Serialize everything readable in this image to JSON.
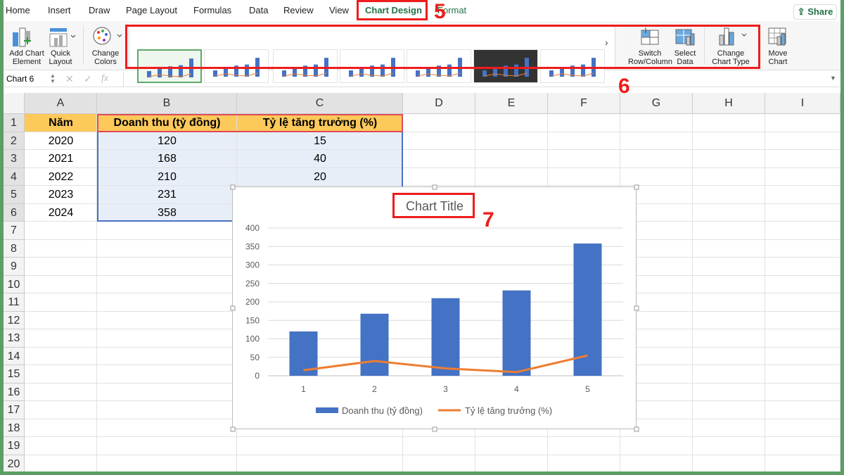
{
  "tabs": [
    "Home",
    "Insert",
    "Draw",
    "Page Layout",
    "Formulas",
    "Data",
    "Review",
    "View",
    "Chart Design",
    "Format"
  ],
  "share_label": "Share",
  "ribbon": {
    "add_chart_element": "Add Chart\nElement",
    "quick_layout": "Quick\nLayout",
    "change_colors": "Change\nColors",
    "switch_row_column": "Switch\nRow/Column",
    "select_data": "Select\nData",
    "change_chart_type": "Change\nChart Type",
    "move_chart": "Move\nChart"
  },
  "formula_bar": {
    "name_box": "Chart 6",
    "fx": "fx",
    "value": ""
  },
  "columns": [
    "A",
    "B",
    "C",
    "D",
    "E",
    "F",
    "G",
    "H",
    "I"
  ],
  "rows": [
    "1",
    "2",
    "3",
    "4",
    "5",
    "6",
    "7",
    "8",
    "9",
    "10",
    "11",
    "12",
    "13",
    "14",
    "15",
    "16",
    "17",
    "18",
    "19",
    "20"
  ],
  "table": {
    "headers": [
      "Năm",
      "Doanh thu (tỷ đồng)",
      "Tỷ lệ tăng trưởng (%)"
    ],
    "rows": [
      [
        "2020",
        "120",
        "15"
      ],
      [
        "2021",
        "168",
        "40"
      ],
      [
        "2022",
        "210",
        "20"
      ],
      [
        "2023",
        "231",
        ""
      ],
      [
        "2024",
        "358",
        ""
      ]
    ]
  },
  "annotations": [
    "5",
    "6",
    "7"
  ],
  "colors": {
    "bar": "#4472c4",
    "line": "#ed7d31",
    "header_fill": "#fdc95b",
    "accent": "#217346"
  },
  "chart_data": {
    "type": "bar+line",
    "title": "Chart Title",
    "categories": [
      "1",
      "2",
      "3",
      "4",
      "5"
    ],
    "series": [
      {
        "name": "Doanh thu (tỷ đồng)",
        "type": "bar",
        "values": [
          120,
          168,
          210,
          231,
          358
        ]
      },
      {
        "name": "Tỷ lệ tăng trưởng (%)",
        "type": "line",
        "values": [
          15,
          40,
          20,
          10,
          55
        ]
      }
    ],
    "ylim": [
      0,
      400
    ],
    "yticks": [
      "0",
      "50",
      "100",
      "150",
      "200",
      "250",
      "300",
      "350",
      "400"
    ],
    "grid": true,
    "legend": "bottom"
  }
}
